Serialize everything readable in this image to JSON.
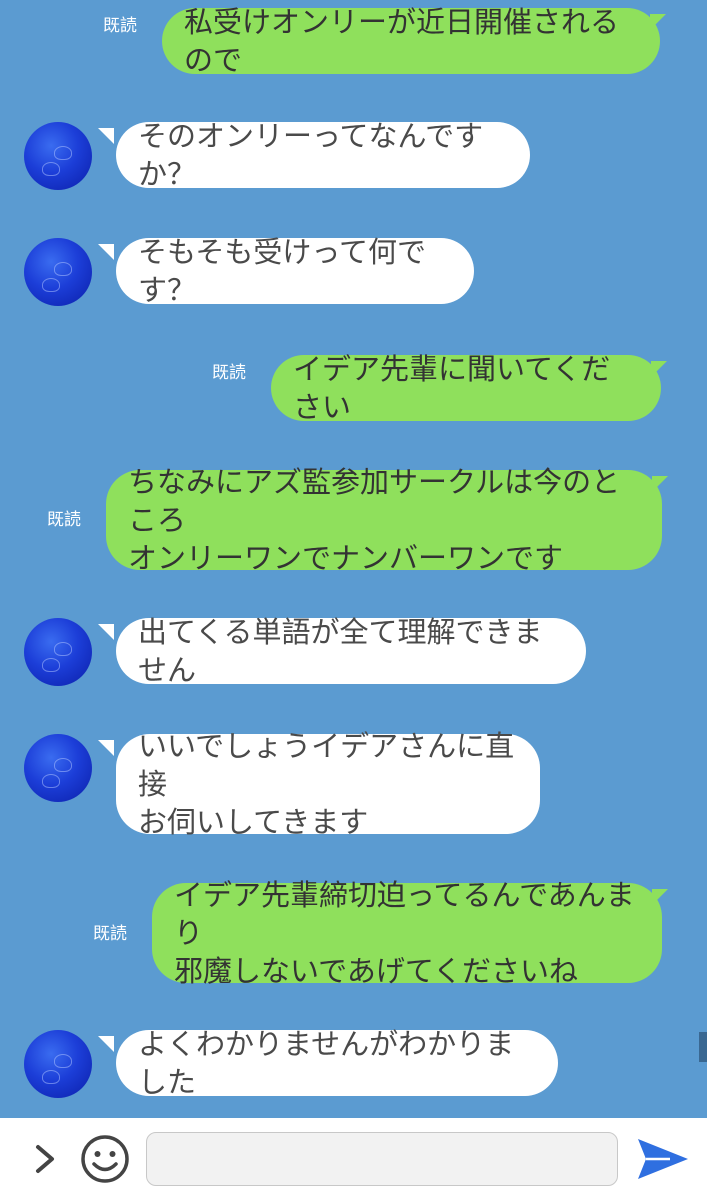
{
  "read_label": "既読",
  "messages": [
    {
      "sender": "me",
      "text": "私受けオンリーが近日開催されるので",
      "read": true
    },
    {
      "sender": "them",
      "text": "そのオンリーってなんですか？"
    },
    {
      "sender": "them",
      "text": "そもそも受けって何です？"
    },
    {
      "sender": "me",
      "text": "イデア先輩に聞いてください",
      "read": true
    },
    {
      "sender": "me",
      "text": "ちなみにアズ監参加サークルは今のところ\nオンリーワンでナンバーワンです",
      "read": true
    },
    {
      "sender": "them",
      "text": "出てくる単語が全て理解できません"
    },
    {
      "sender": "them",
      "text": "いいでしょうイデアさんに直接\nお伺いしてきます"
    },
    {
      "sender": "me",
      "text": "イデア先輩締切迫ってるんであんまり\n邪魔しないであげてくださいね",
      "read": true
    },
    {
      "sender": "them",
      "text": "よくわかりませんがわかりました"
    }
  ],
  "input": {
    "value": "",
    "placeholder": ""
  },
  "icons": {
    "expand": "chevron-right-icon",
    "emoji": "smiley-icon",
    "send": "send-icon"
  },
  "colors": {
    "background": "#5b9bd1",
    "my_bubble": "#8fe05c",
    "their_bubble": "#ffffff",
    "send": "#2f6fe0"
  }
}
